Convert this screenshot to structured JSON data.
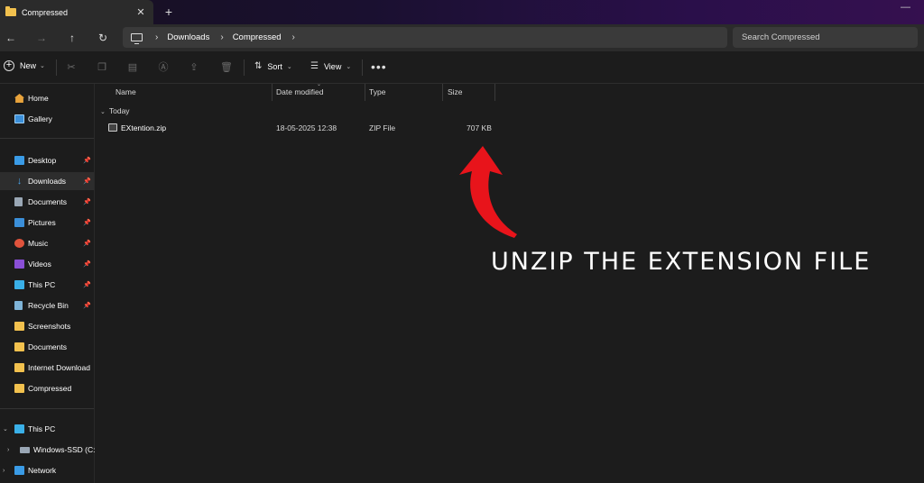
{
  "window": {
    "tab_title": "Compressed",
    "close_glyph": "✕",
    "new_tab_glyph": "+",
    "minimize_glyph": "—"
  },
  "address_bar": {
    "breadcrumb": [
      "Downloads",
      "Compressed"
    ],
    "search_placeholder": "Search Compressed"
  },
  "toolbar": {
    "new_label": "New",
    "sort_label": "Sort",
    "view_label": "View",
    "more_glyph": "•••"
  },
  "sidebar": {
    "top": [
      {
        "label": "Home",
        "icon": "home-icon"
      },
      {
        "label": "Gallery",
        "icon": "gallery-icon"
      }
    ],
    "quick_access": [
      {
        "label": "Desktop",
        "icon": "desktop-icon",
        "pinned": true
      },
      {
        "label": "Downloads",
        "icon": "downloads-icon",
        "pinned": true,
        "active": true
      },
      {
        "label": "Documents",
        "icon": "documents-icon",
        "pinned": true
      },
      {
        "label": "Pictures",
        "icon": "pictures-icon",
        "pinned": true
      },
      {
        "label": "Music",
        "icon": "music-icon",
        "pinned": true
      },
      {
        "label": "Videos",
        "icon": "videos-icon",
        "pinned": true
      },
      {
        "label": "This PC",
        "icon": "this-pc-icon",
        "pinned": true
      },
      {
        "label": "Recycle Bin",
        "icon": "recycle-bin-icon",
        "pinned": true
      },
      {
        "label": "Screenshots",
        "icon": "folder-icon"
      },
      {
        "label": "Documents",
        "icon": "folder-icon"
      },
      {
        "label": "Internet Download",
        "icon": "folder-icon"
      },
      {
        "label": "Compressed",
        "icon": "folder-icon"
      }
    ],
    "tree": [
      {
        "label": "This PC",
        "icon": "this-pc-icon",
        "expanded": true
      },
      {
        "label": "Windows-SSD (C:",
        "icon": "drive-icon"
      },
      {
        "label": "Network",
        "icon": "network-icon"
      }
    ]
  },
  "file_list": {
    "columns": [
      "Name",
      "Date modified",
      "Type",
      "Size"
    ],
    "group": "Today",
    "rows": [
      {
        "name": "EXtention.zip",
        "date": "18-05-2025 12:38",
        "type": "ZIP File",
        "size": "707 KB"
      }
    ]
  },
  "annotation": {
    "text": "UNZIP THE EXTENSION FILE",
    "arrow_color": "#e8141b"
  },
  "colors": {
    "folder": "#f2c14e",
    "background": "#1c1c1c",
    "accent": "#4aa3e8"
  }
}
